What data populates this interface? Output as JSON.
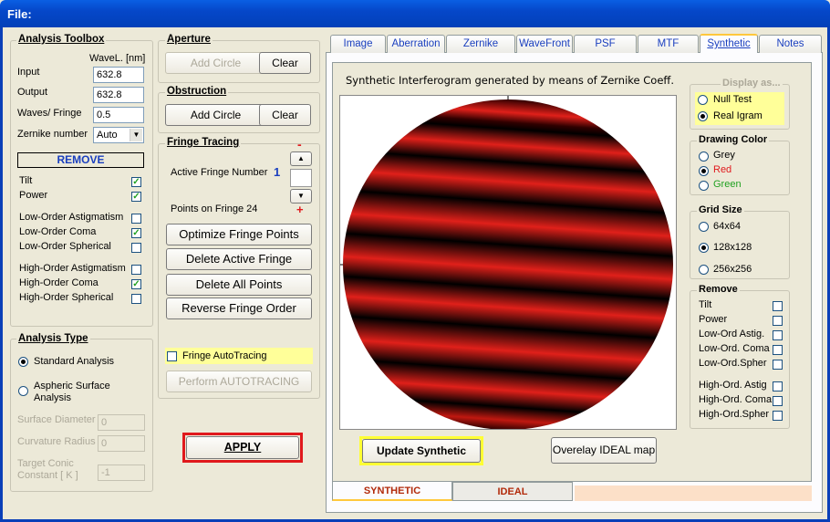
{
  "window": {
    "title": "File:"
  },
  "toolbox": {
    "title": "Analysis Toolbox",
    "wavel_header": "WaveL. [nm]",
    "input_label": "Input",
    "input_value": "632.8",
    "output_label": "Output",
    "output_value": "632.8",
    "waves_label": "Waves/ Fringe",
    "waves_value": "0.5",
    "zernike_label": "Zernike number",
    "zernike_value": "Auto",
    "remove_label": "REMOVE",
    "items": [
      {
        "label": "Tilt",
        "checked": true
      },
      {
        "label": "Power",
        "checked": true
      },
      {
        "label": "Low-Order Astigmatism",
        "checked": false
      },
      {
        "label": "Low-Order Coma",
        "checked": true
      },
      {
        "label": "Low-Order Spherical",
        "checked": false
      },
      {
        "label": "High-Order Astigmatism",
        "checked": false
      },
      {
        "label": "High-Order Coma",
        "checked": true
      },
      {
        "label": "High-Order Spherical",
        "checked": false
      }
    ]
  },
  "analysis_type": {
    "title": "Analysis Type",
    "standard": "Standard Analysis",
    "aspheric": "Aspheric Surface Analysis",
    "surface_diameter_label": "Surface Diameter",
    "surface_diameter_value": "0",
    "curvature_radius_label": "Curvature Radius",
    "curvature_radius_value": "0",
    "target_conic_label": "Target Conic Constant [ K ]",
    "target_conic_value": "-1"
  },
  "aperture": {
    "title": "Aperture",
    "add_label": "Add Circle",
    "clear_label": "Clear"
  },
  "obstruction": {
    "title": "Obstruction",
    "add_label": "Add Circle",
    "clear_label": "Clear"
  },
  "fringe": {
    "title": "Fringe Tracing",
    "minus": "-",
    "plus": "+",
    "active_label": "Active Fringe Number",
    "active_value": "1",
    "points_label": "Points on  Fringe 24",
    "optimize_label": "Optimize Fringe Points",
    "delete_active_label": "Delete Active Fringe",
    "delete_all_label": "Delete  All Points",
    "reverse_label": "Reverse  Fringe Order",
    "autotracing_label": "Fringe AutoTracing",
    "perform_label": "Perform  AUTOTRACING"
  },
  "apply_label": "APPLY",
  "tabs": [
    "Image",
    "Aberration",
    "Zernike",
    "WaveFront",
    "PSF",
    "MTF",
    "Synthetic",
    "Notes"
  ],
  "active_tab": "Synthetic",
  "synthetic": {
    "caption": "Synthetic Interferogram generated by means of Zernike Coeff.",
    "update_label": "Update Synthetic",
    "overlay_label": "Overelay IDEAL map"
  },
  "display_as": {
    "title": "Display as...",
    "null_test": "Null Test",
    "real_igram": "Real Igram"
  },
  "drawing_color": {
    "title": "Drawing Color",
    "grey": "Grey",
    "red": "Red",
    "green": "Green",
    "selected": "Red"
  },
  "grid_size": {
    "title": "Grid Size",
    "o64": "64x64",
    "o128": "128x128",
    "o256": "256x256",
    "selected": "128x128"
  },
  "remove2": {
    "title": "Remove",
    "items": [
      "Tilt",
      "Power",
      "Low-Ord Astig.",
      "Low-Ord. Coma",
      "Low-Ord.Spher",
      "High-Ord. Astig",
      "High-Ord. Coma",
      "High-Ord.Spher"
    ]
  },
  "bottom_tabs": [
    "SYNTHETIC",
    "IDEAL"
  ],
  "colors": {
    "fringe_red": "#E0201A",
    "fringe_dark": "#000000",
    "accent_yellow": "#FFFF99",
    "apply_border": "#E0191C"
  }
}
